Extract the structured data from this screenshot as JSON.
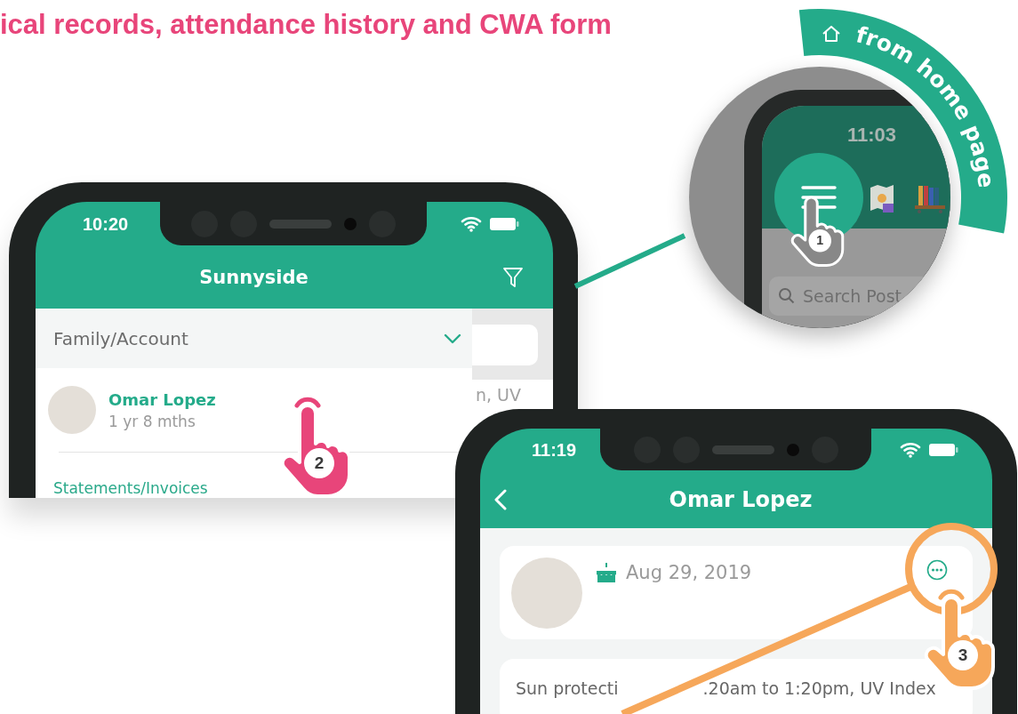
{
  "heading": "ical records, attendance history and CWA form",
  "badge": {
    "label": "from home page"
  },
  "callout": {
    "time": "11:03",
    "search_placeholder": "Search Post",
    "step": "1"
  },
  "phone_sunnyside": {
    "time": "10:20",
    "title": "Sunnyside",
    "section": {
      "label": "Family/Account",
      "expanded": true
    },
    "items": [
      {
        "name": "Omar Lopez",
        "age": "1 yr 8 mths"
      }
    ],
    "next_item": "Statements/Invoices",
    "background_text": "n, UV",
    "step": "2"
  },
  "phone_profile": {
    "time": "11:19",
    "title": "Omar Lopez",
    "birthday": "Aug 29, 2019",
    "note": [
      "Sun protecti",
      ".20am to 1:20pm, UV Index"
    ],
    "step": "3"
  }
}
